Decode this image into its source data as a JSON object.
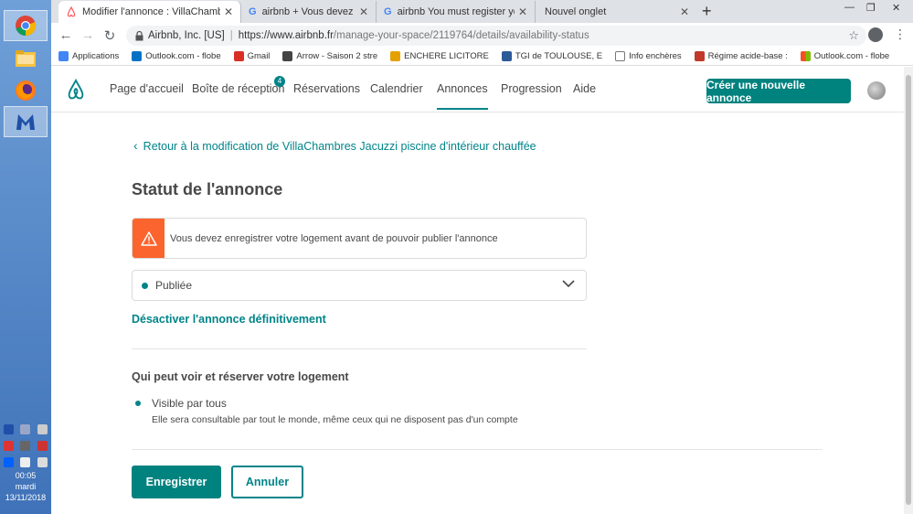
{
  "taskbar": {
    "apps": [
      {
        "name": "chrome",
        "active": true
      },
      {
        "name": "file-explorer",
        "active": false
      },
      {
        "name": "firefox",
        "active": false
      },
      {
        "name": "malwarebytes",
        "active": true
      }
    ],
    "clock_time": "00:05",
    "clock_day": "mardi",
    "clock_date": "13/11/2018"
  },
  "browser": {
    "tabs": [
      {
        "title": "Modifier l'annonce : VillaChambres",
        "active": true,
        "icon": "airbnb-icon"
      },
      {
        "title": "airbnb + Vous devez enregistrer",
        "active": false,
        "icon": "google-icon"
      },
      {
        "title": "airbnb You must register your ho",
        "active": false,
        "icon": "google-icon"
      },
      {
        "title": "Nouvel onglet",
        "active": false,
        "icon": ""
      }
    ],
    "secure_label": "Airbnb, Inc. [US]",
    "url_host": "https://www.airbnb.fr",
    "url_path": "/manage-your-space/2119764/details/availability-status",
    "bookmarks": [
      {
        "label": "Applications",
        "color": "#4285f4"
      },
      {
        "label": "Outlook.com - flobe",
        "color": "#0072c6"
      },
      {
        "label": "Gmail",
        "color": "#d93025"
      },
      {
        "label": "Arrow - Saison 2 stre",
        "color": "#444444"
      },
      {
        "label": "ENCHERE LICITORE",
        "color": "#e5a000"
      },
      {
        "label": "TGI de TOULOUSE, E",
        "color": "#2d5b9a"
      },
      {
        "label": "Info enchères",
        "color": "#777777"
      },
      {
        "label": "Régime acide-base :",
        "color": "#c0392b"
      },
      {
        "label": "Outlook.com - flobe",
        "color": "#f25022"
      }
    ]
  },
  "header": {
    "nav": [
      {
        "label": "Page d'accueil"
      },
      {
        "label": "Boîte de réception"
      },
      {
        "label": "Réservations"
      },
      {
        "label": "Calendrier"
      },
      {
        "label": "Annonces"
      },
      {
        "label": "Progression"
      },
      {
        "label": "Aide"
      }
    ],
    "inbox_badge": "4",
    "create_label": "Créer une nouvelle annonce"
  },
  "content": {
    "back_link": "Retour à la modification de VillaChambres Jacuzzi piscine d'intérieur chauffée",
    "title": "Statut de l'annonce",
    "alert_text": "Vous devez enregistrer votre logement avant de pouvoir publier l'annonce",
    "status_value": "Publiée",
    "deactivate_label": "Désactiver l'annonce définitivement",
    "who_title": "Qui peut voir et réserver votre logement",
    "visibility_label": "Visible par tous",
    "visibility_desc": "Elle sera consultable par tout le monde, même ceux qui ne disposent pas d'un compte",
    "save_label": "Enregistrer",
    "cancel_label": "Annuler"
  },
  "colors": {
    "accent": "#008489",
    "alert": "#fc642d"
  }
}
